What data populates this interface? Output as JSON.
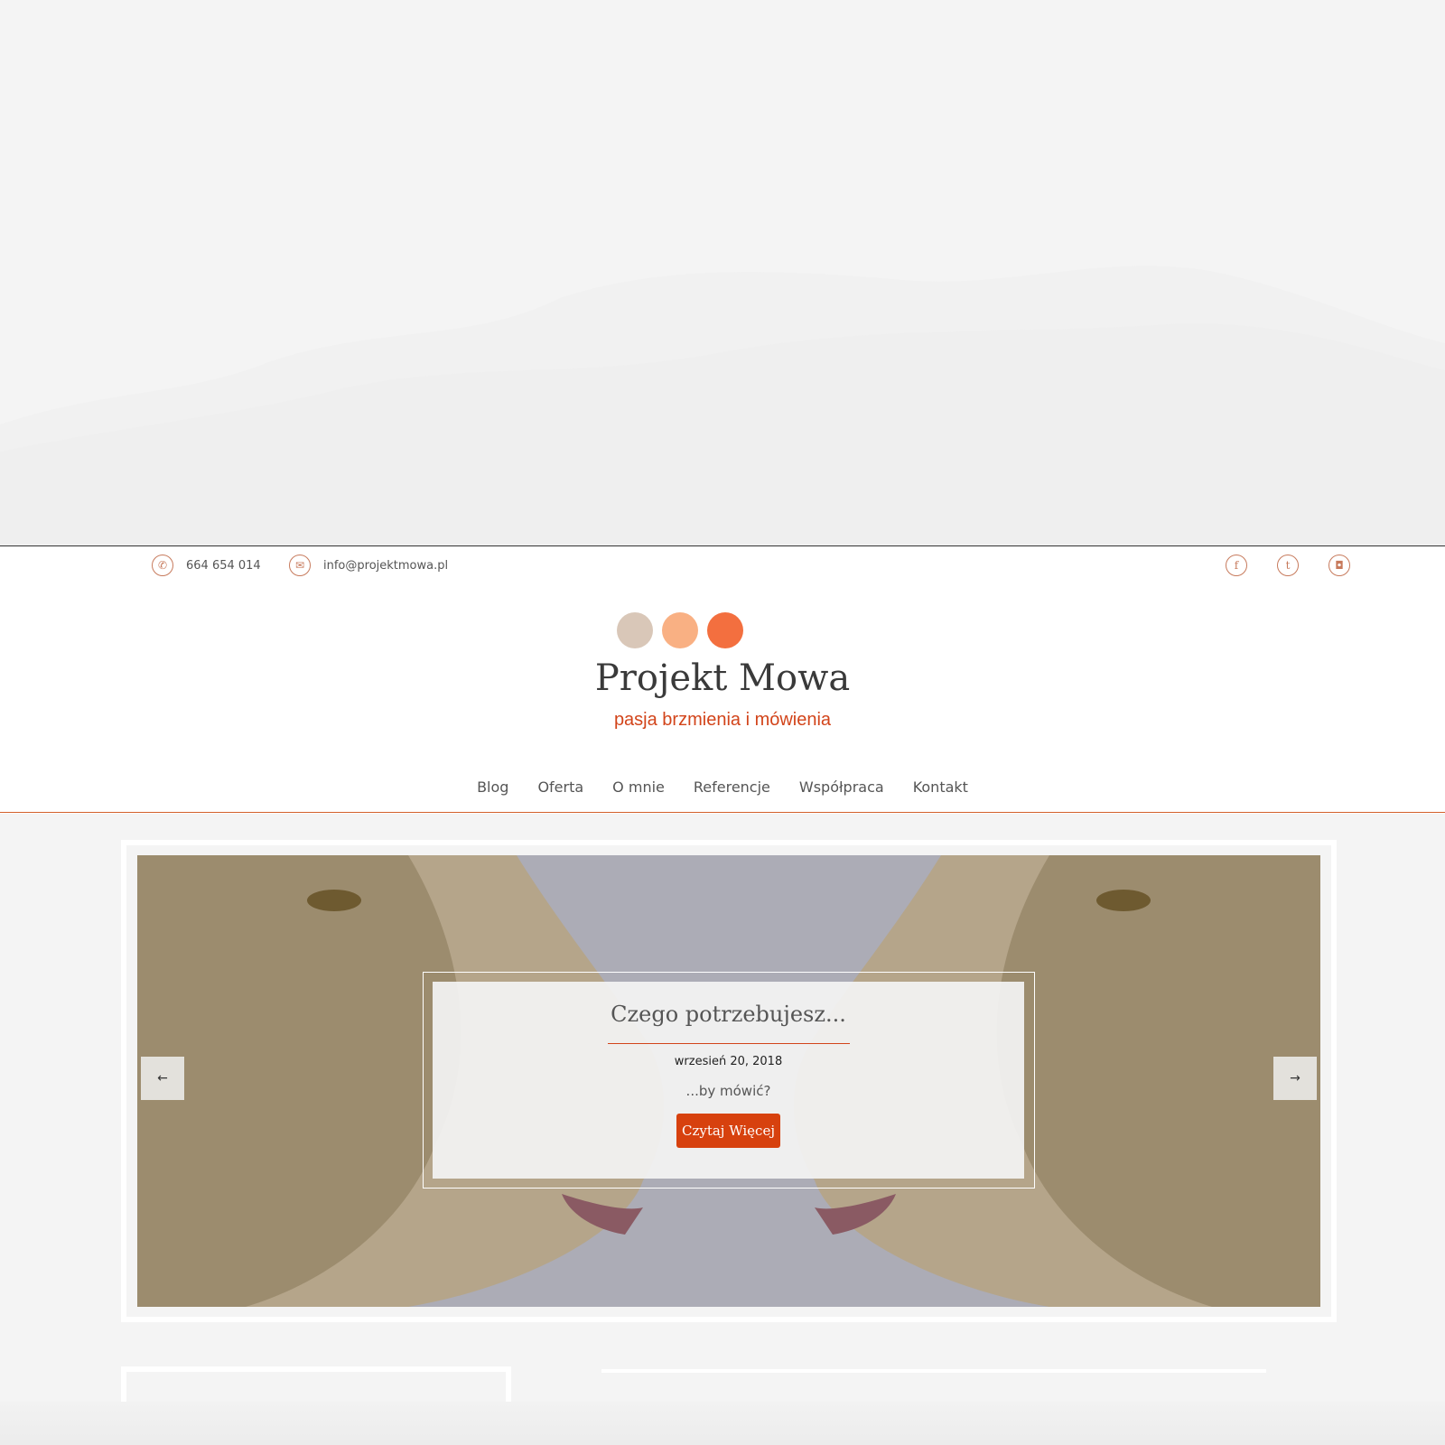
{
  "contact": {
    "phone": "664 654 014",
    "email": "info@projektmowa.pl",
    "phone_icon": "phone-icon",
    "email_icon": "envelope-icon"
  },
  "social": [
    "facebook-icon",
    "twitter-icon",
    "instagram-icon"
  ],
  "brand": {
    "title": "Projekt Mowa",
    "tagline": "pasja brzmienia i mówienia",
    "dot_colors": [
      "#d9c7b8",
      "#f9b083",
      "#f36f3f"
    ]
  },
  "nav": [
    "Blog",
    "Oferta",
    "O mnie",
    "Referencje",
    "Współpraca",
    "Kontakt"
  ],
  "slider": {
    "title": "Czego potrzebujesz...",
    "date": "wrzesień 20, 2018",
    "excerpt": "...by mówić?",
    "button": "Czytaj Więcej",
    "prev": "←",
    "next": "→"
  },
  "colors": {
    "accent": "#d7410e",
    "icon": "#c77a5c"
  }
}
